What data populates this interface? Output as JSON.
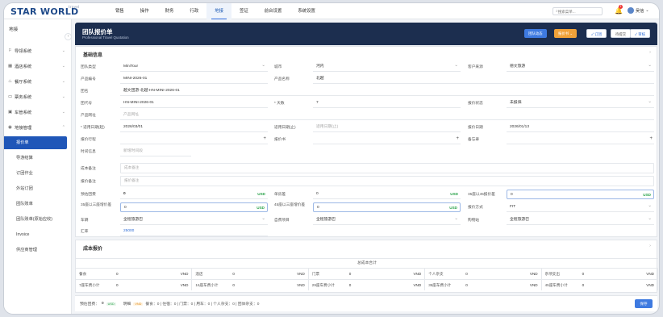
{
  "app": {
    "logo": "STAR WORLD",
    "logo_sub": "travel"
  },
  "nav": {
    "items": [
      "销售",
      "操作",
      "财务",
      "行政",
      "地接",
      "签证",
      "前台设置",
      "系统设置"
    ],
    "active_index": 4,
    "search_placeholder": "搜索菜单...",
    "notif_count": "1",
    "user_name": "吴信"
  },
  "sidebar": {
    "title": "地接",
    "groups": [
      {
        "label": "导领系统",
        "icon": "flag-icon"
      },
      {
        "label": "酒店系统",
        "icon": "hotel-icon"
      },
      {
        "label": "餐厅系统",
        "icon": "restaurant-icon"
      },
      {
        "label": "票务系统",
        "icon": "ticket-icon"
      },
      {
        "label": "车管系统",
        "icon": "car-icon"
      },
      {
        "label": "地接管理",
        "icon": "manage-icon"
      }
    ],
    "subitems": [
      "报价单",
      "导游结算",
      "订团作业",
      "外站订团",
      "团队账单",
      "团队账单(原始应收)",
      "Invoice",
      "供应商管理"
    ],
    "active_sub": 0
  },
  "header": {
    "title": "团队报价单",
    "subtitle": "Professional Travel Quotation",
    "buttons": {
      "status": "团队动态",
      "docs": "报价书 ⌄",
      "order": "订团",
      "submit": "待提交",
      "review": "审核"
    }
  },
  "basic": {
    "title": "基础信息",
    "team_type_label": "团队类型",
    "team_type": "MiniTour",
    "city_label": "城市",
    "city": "河内",
    "source_label": "客户来源",
    "source": "德文旅游",
    "product_code_label": "产品编号",
    "product_code": "MINI-2026-01",
    "product_name_label": "产品名称",
    "product_name": "北越",
    "group_name_label": "团名",
    "group_name": "越文团游-北越-HN-MINI-2026-01",
    "team_code_label": "团代号",
    "team_code": "HN-MINI-2026-01",
    "days_label": "* 天数",
    "days": "7",
    "quote_status_label": "报价状态",
    "quote_status": "未报価",
    "product_url_label": "产品网址",
    "product_url_ph": "产品网址",
    "start_date_label": "* 适用日期(起)",
    "start_date": "2026/03/01",
    "end_date_label": "适用日期(止)",
    "end_date_ph": "适用日期(止)",
    "quote_date_label": "报价日期",
    "quote_date": "2026/01/13",
    "itinerary_label": "报价行程",
    "quote_book_label": "报价书",
    "memo_label": "备忘录",
    "timeline_label": "时间信息",
    "timeline_ph": "新增时间段",
    "cost_note_label": "成本备注",
    "cost_note_ph": "成本备注",
    "quote_note_label": "报价备注",
    "quote_note_ph": "报价备注",
    "expected_price_label": "预估团费",
    "expected_price": "0",
    "expected_unit": "USD",
    "single_diff_label": "单房差",
    "single_diff": "0",
    "single_unit": "USD",
    "price35_label": "35座以45报价差",
    "price35": "0",
    "price35_unit": "USD",
    "child_label": "35座以三座增价差",
    "child": "0",
    "child_unit": "USD",
    "child2_label": "45座以三座增价差",
    "child2": "0",
    "child2_unit": "USD",
    "quote_method_label": "报价方式",
    "quote_method": "FIT",
    "vehicle_label": "车辆",
    "vehicle": "全程旅游巴",
    "self_item_label": "自费项目",
    "self_item": "全程旅游巴",
    "shopping_label": "购物站",
    "shopping": "全程旅游巴",
    "rate_label": "汇率",
    "rate": "25000"
  },
  "cost": {
    "title": "成本报价",
    "total_head": "总成本合计",
    "cells": [
      {
        "label": "餐食",
        "value": "0",
        "unit": "VND"
      },
      {
        "label": "酒店",
        "value": "0",
        "unit": "VND"
      },
      {
        "label": "门票",
        "value": "0",
        "unit": "VND"
      },
      {
        "label": "个人杂支",
        "value": "0",
        "unit": "VND"
      },
      {
        "label": "杂项支出",
        "value": "0",
        "unit": "VND"
      },
      {
        "label": "7座车费小计",
        "value": "0",
        "unit": "VND"
      },
      {
        "label": "16座车费小计",
        "value": "0",
        "unit": "VND"
      },
      {
        "label": "29座车费小计",
        "value": "0",
        "unit": "VND"
      },
      {
        "label": "35座车费小计",
        "value": "0",
        "unit": "VND"
      },
      {
        "label": "45座车费小计",
        "value": "0",
        "unit": "VND"
      }
    ]
  },
  "footer": {
    "expected": "预估团费：",
    "expected_val": "0",
    "unit": "USD",
    "detail_label": "明细",
    "detail_tag": "VND",
    "detail": "餐食：0  |  住宿：0  |  门票：0  |  用车：0  |  个人杂支：0  |  团体杂支：0",
    "save": "保存"
  }
}
